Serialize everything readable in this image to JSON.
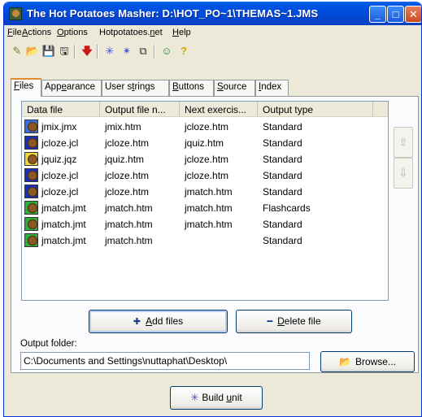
{
  "window": {
    "title": "The Hot Potatoes Masher: D:\\HOT_PO~1\\THEMAS~1.JMS",
    "controls": {
      "minimize": "_",
      "maximize": "□",
      "close": "✕"
    }
  },
  "menu": [
    {
      "pre": "",
      "key": "F",
      "post": "ile"
    },
    {
      "pre": "",
      "key": "A",
      "post": "ctions"
    },
    {
      "pre": "",
      "key": "O",
      "post": "ptions"
    },
    {
      "pre": "Hotpotatoes.",
      "key": "n",
      "post": "et"
    },
    {
      "pre": "",
      "key": "H",
      "post": "elp"
    }
  ],
  "toolbar": {
    "icons": [
      "new-file-icon",
      "open-folder-icon",
      "save-icon",
      "save-as-icon",
      "red-arrow-down-icon",
      "net-icon",
      "net-settings-icon",
      "copy-icon",
      "potato-icon",
      "help-question-icon"
    ],
    "glyphs": [
      "✎",
      "📂",
      "💾",
      "🖫",
      "🡇",
      "✳",
      "✴",
      "⧉",
      "☺",
      "?"
    ]
  },
  "tabs": [
    {
      "pre": "",
      "key": "F",
      "post": "iles",
      "active": true
    },
    {
      "pre": "App",
      "key": "e",
      "post": "arance",
      "active": false
    },
    {
      "pre": "User s",
      "key": "t",
      "post": "rings",
      "active": false
    },
    {
      "pre": "",
      "key": "B",
      "post": "uttons",
      "active": false
    },
    {
      "pre": "",
      "key": "S",
      "post": "ource",
      "active": false
    },
    {
      "pre": "",
      "key": "I",
      "post": "ndex",
      "active": false
    }
  ],
  "table": {
    "columns": [
      "Data file",
      "Output file n...",
      "Next exercis...",
      "Output type"
    ],
    "rows": [
      {
        "icon": "jmix",
        "color": "#3a6ee8",
        "data_file": "jmix.jmx",
        "output_file": "jmix.htm",
        "next": "jcloze.htm",
        "type": "Standard"
      },
      {
        "icon": "jcloze",
        "color": "#1a2fbf",
        "data_file": "jcloze.jcl",
        "output_file": "jcloze.htm",
        "next": "jquiz.htm",
        "type": "Standard"
      },
      {
        "icon": "jquiz",
        "color": "#e8d63a",
        "data_file": "jquiz.jqz",
        "output_file": "jquiz.htm",
        "next": "jcloze.htm",
        "type": "Standard"
      },
      {
        "icon": "jcloze",
        "color": "#1a2fbf",
        "data_file": "jcloze.jcl",
        "output_file": "jcloze.htm",
        "next": "jcloze.htm",
        "type": "Standard"
      },
      {
        "icon": "jcloze",
        "color": "#1a2fbf",
        "data_file": "jcloze.jcl",
        "output_file": "jcloze.htm",
        "next": "jmatch.htm",
        "type": "Standard"
      },
      {
        "icon": "jmatch",
        "color": "#2fae3a",
        "data_file": "jmatch.jmt",
        "output_file": "jmatch.htm",
        "next": "jmatch.htm",
        "type": "Flashcards"
      },
      {
        "icon": "jmatch",
        "color": "#2fae3a",
        "data_file": "jmatch.jmt",
        "output_file": "jmatch.htm",
        "next": "jmatch.htm",
        "type": "Standard"
      },
      {
        "icon": "jmatch",
        "color": "#2fae3a",
        "data_file": "jmatch.jmt",
        "output_file": "jmatch.htm",
        "next": "",
        "type": "Standard"
      }
    ]
  },
  "side_buttons": {
    "up": "⇧",
    "down": "⇩"
  },
  "buttons": {
    "add_glyph": "✚",
    "add_pre": "",
    "add_key": "A",
    "add_post": "dd files",
    "delete_glyph": "━",
    "delete_pre": "",
    "delete_key": "D",
    "delete_post": "elete file",
    "browse_glyph": "📂",
    "browse_label": "Browse...",
    "build_glyph": "✳",
    "build_pre": "Build ",
    "build_key": "u",
    "build_post": "nit"
  },
  "output_folder": {
    "label": "Output folder:",
    "value": "C:\\Documents and Settings\\nuttaphat\\Desktop\\"
  },
  "colors": {
    "title_bar": "#0054e3",
    "tab_highlight": "#e68b2c",
    "window_bg": "#ece9d8"
  }
}
